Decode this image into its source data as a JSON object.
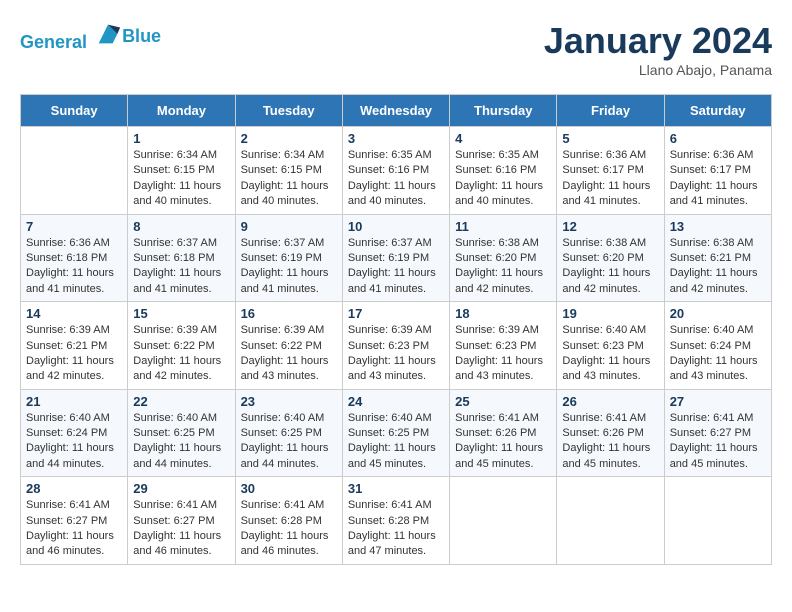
{
  "header": {
    "logo_line1": "General",
    "logo_line2": "Blue",
    "month_title": "January 2024",
    "location": "Llano Abajo, Panama"
  },
  "days_of_week": [
    "Sunday",
    "Monday",
    "Tuesday",
    "Wednesday",
    "Thursday",
    "Friday",
    "Saturday"
  ],
  "weeks": [
    [
      {
        "num": "",
        "info": ""
      },
      {
        "num": "1",
        "info": "Sunrise: 6:34 AM\nSunset: 6:15 PM\nDaylight: 11 hours and 40 minutes."
      },
      {
        "num": "2",
        "info": "Sunrise: 6:34 AM\nSunset: 6:15 PM\nDaylight: 11 hours and 40 minutes."
      },
      {
        "num": "3",
        "info": "Sunrise: 6:35 AM\nSunset: 6:16 PM\nDaylight: 11 hours and 40 minutes."
      },
      {
        "num": "4",
        "info": "Sunrise: 6:35 AM\nSunset: 6:16 PM\nDaylight: 11 hours and 40 minutes."
      },
      {
        "num": "5",
        "info": "Sunrise: 6:36 AM\nSunset: 6:17 PM\nDaylight: 11 hours and 41 minutes."
      },
      {
        "num": "6",
        "info": "Sunrise: 6:36 AM\nSunset: 6:17 PM\nDaylight: 11 hours and 41 minutes."
      }
    ],
    [
      {
        "num": "7",
        "info": "Sunrise: 6:36 AM\nSunset: 6:18 PM\nDaylight: 11 hours and 41 minutes."
      },
      {
        "num": "8",
        "info": "Sunrise: 6:37 AM\nSunset: 6:18 PM\nDaylight: 11 hours and 41 minutes."
      },
      {
        "num": "9",
        "info": "Sunrise: 6:37 AM\nSunset: 6:19 PM\nDaylight: 11 hours and 41 minutes."
      },
      {
        "num": "10",
        "info": "Sunrise: 6:37 AM\nSunset: 6:19 PM\nDaylight: 11 hours and 41 minutes."
      },
      {
        "num": "11",
        "info": "Sunrise: 6:38 AM\nSunset: 6:20 PM\nDaylight: 11 hours and 42 minutes."
      },
      {
        "num": "12",
        "info": "Sunrise: 6:38 AM\nSunset: 6:20 PM\nDaylight: 11 hours and 42 minutes."
      },
      {
        "num": "13",
        "info": "Sunrise: 6:38 AM\nSunset: 6:21 PM\nDaylight: 11 hours and 42 minutes."
      }
    ],
    [
      {
        "num": "14",
        "info": "Sunrise: 6:39 AM\nSunset: 6:21 PM\nDaylight: 11 hours and 42 minutes."
      },
      {
        "num": "15",
        "info": "Sunrise: 6:39 AM\nSunset: 6:22 PM\nDaylight: 11 hours and 42 minutes."
      },
      {
        "num": "16",
        "info": "Sunrise: 6:39 AM\nSunset: 6:22 PM\nDaylight: 11 hours and 43 minutes."
      },
      {
        "num": "17",
        "info": "Sunrise: 6:39 AM\nSunset: 6:23 PM\nDaylight: 11 hours and 43 minutes."
      },
      {
        "num": "18",
        "info": "Sunrise: 6:39 AM\nSunset: 6:23 PM\nDaylight: 11 hours and 43 minutes."
      },
      {
        "num": "19",
        "info": "Sunrise: 6:40 AM\nSunset: 6:23 PM\nDaylight: 11 hours and 43 minutes."
      },
      {
        "num": "20",
        "info": "Sunrise: 6:40 AM\nSunset: 6:24 PM\nDaylight: 11 hours and 43 minutes."
      }
    ],
    [
      {
        "num": "21",
        "info": "Sunrise: 6:40 AM\nSunset: 6:24 PM\nDaylight: 11 hours and 44 minutes."
      },
      {
        "num": "22",
        "info": "Sunrise: 6:40 AM\nSunset: 6:25 PM\nDaylight: 11 hours and 44 minutes."
      },
      {
        "num": "23",
        "info": "Sunrise: 6:40 AM\nSunset: 6:25 PM\nDaylight: 11 hours and 44 minutes."
      },
      {
        "num": "24",
        "info": "Sunrise: 6:40 AM\nSunset: 6:25 PM\nDaylight: 11 hours and 45 minutes."
      },
      {
        "num": "25",
        "info": "Sunrise: 6:41 AM\nSunset: 6:26 PM\nDaylight: 11 hours and 45 minutes."
      },
      {
        "num": "26",
        "info": "Sunrise: 6:41 AM\nSunset: 6:26 PM\nDaylight: 11 hours and 45 minutes."
      },
      {
        "num": "27",
        "info": "Sunrise: 6:41 AM\nSunset: 6:27 PM\nDaylight: 11 hours and 45 minutes."
      }
    ],
    [
      {
        "num": "28",
        "info": "Sunrise: 6:41 AM\nSunset: 6:27 PM\nDaylight: 11 hours and 46 minutes."
      },
      {
        "num": "29",
        "info": "Sunrise: 6:41 AM\nSunset: 6:27 PM\nDaylight: 11 hours and 46 minutes."
      },
      {
        "num": "30",
        "info": "Sunrise: 6:41 AM\nSunset: 6:28 PM\nDaylight: 11 hours and 46 minutes."
      },
      {
        "num": "31",
        "info": "Sunrise: 6:41 AM\nSunset: 6:28 PM\nDaylight: 11 hours and 47 minutes."
      },
      {
        "num": "",
        "info": ""
      },
      {
        "num": "",
        "info": ""
      },
      {
        "num": "",
        "info": ""
      }
    ]
  ]
}
